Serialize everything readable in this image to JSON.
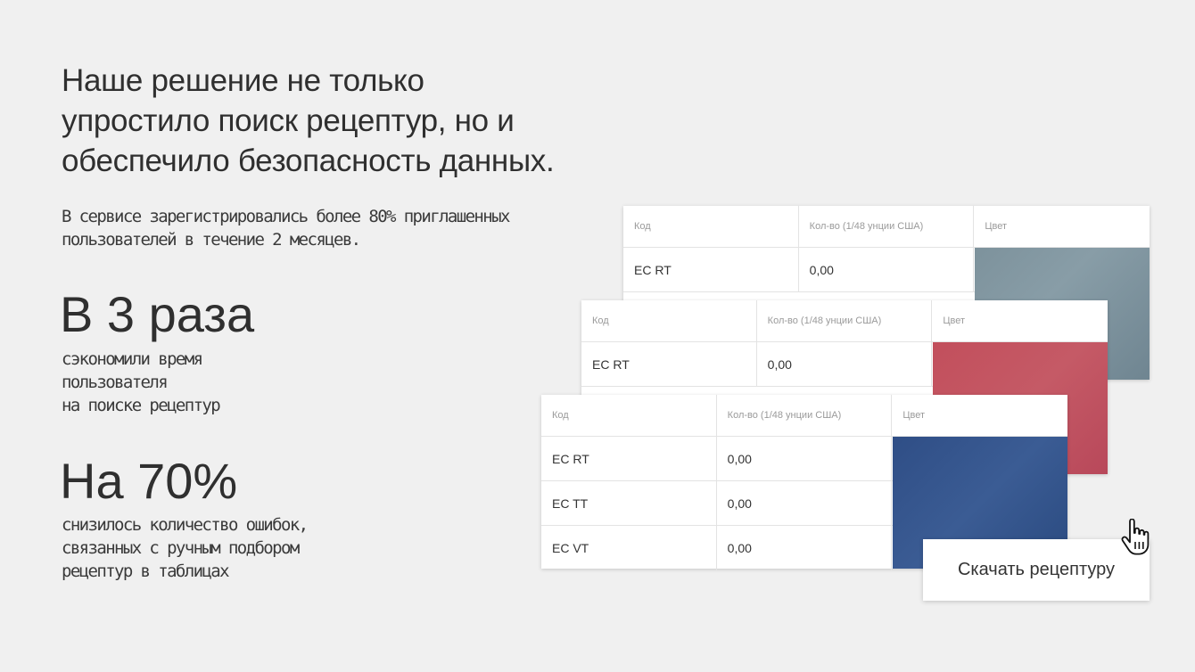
{
  "headline": "Наше решение не только упростило поиск рецептур, но и обеспечило безопасность данных.",
  "lead": "В сервисе зарегистрировались более 80% приглашенных пользователей в течение 2 месяцев.",
  "stats": [
    {
      "value": "В 3 раза",
      "text": "сэкономили время\nпользователя\nна поиске рецептур"
    },
    {
      "value": "На 70%",
      "text": "снизилось количество ошибок,\nсвязанных с ручным подбором\nрецептур в таблицах"
    }
  ],
  "table": {
    "headers": [
      "Код",
      "Кол-во (1/48 унции США)",
      "Цвет"
    ],
    "back_rows": [
      [
        "EC RT",
        "0,00"
      ]
    ],
    "mid_rows": [
      [
        "EC RT",
        "0,00"
      ]
    ],
    "front_rows": [
      [
        "EC RT",
        "0,00"
      ],
      [
        "EC TT",
        "0,00"
      ],
      [
        "EC VT",
        "0,00"
      ]
    ],
    "swatch_colors": {
      "back": "#7f949e",
      "mid": "#c24f5c",
      "front": "#2f4e86"
    }
  },
  "download_button": "Скачать рецептуру",
  "cursor_icon": "hand-pointer-icon"
}
